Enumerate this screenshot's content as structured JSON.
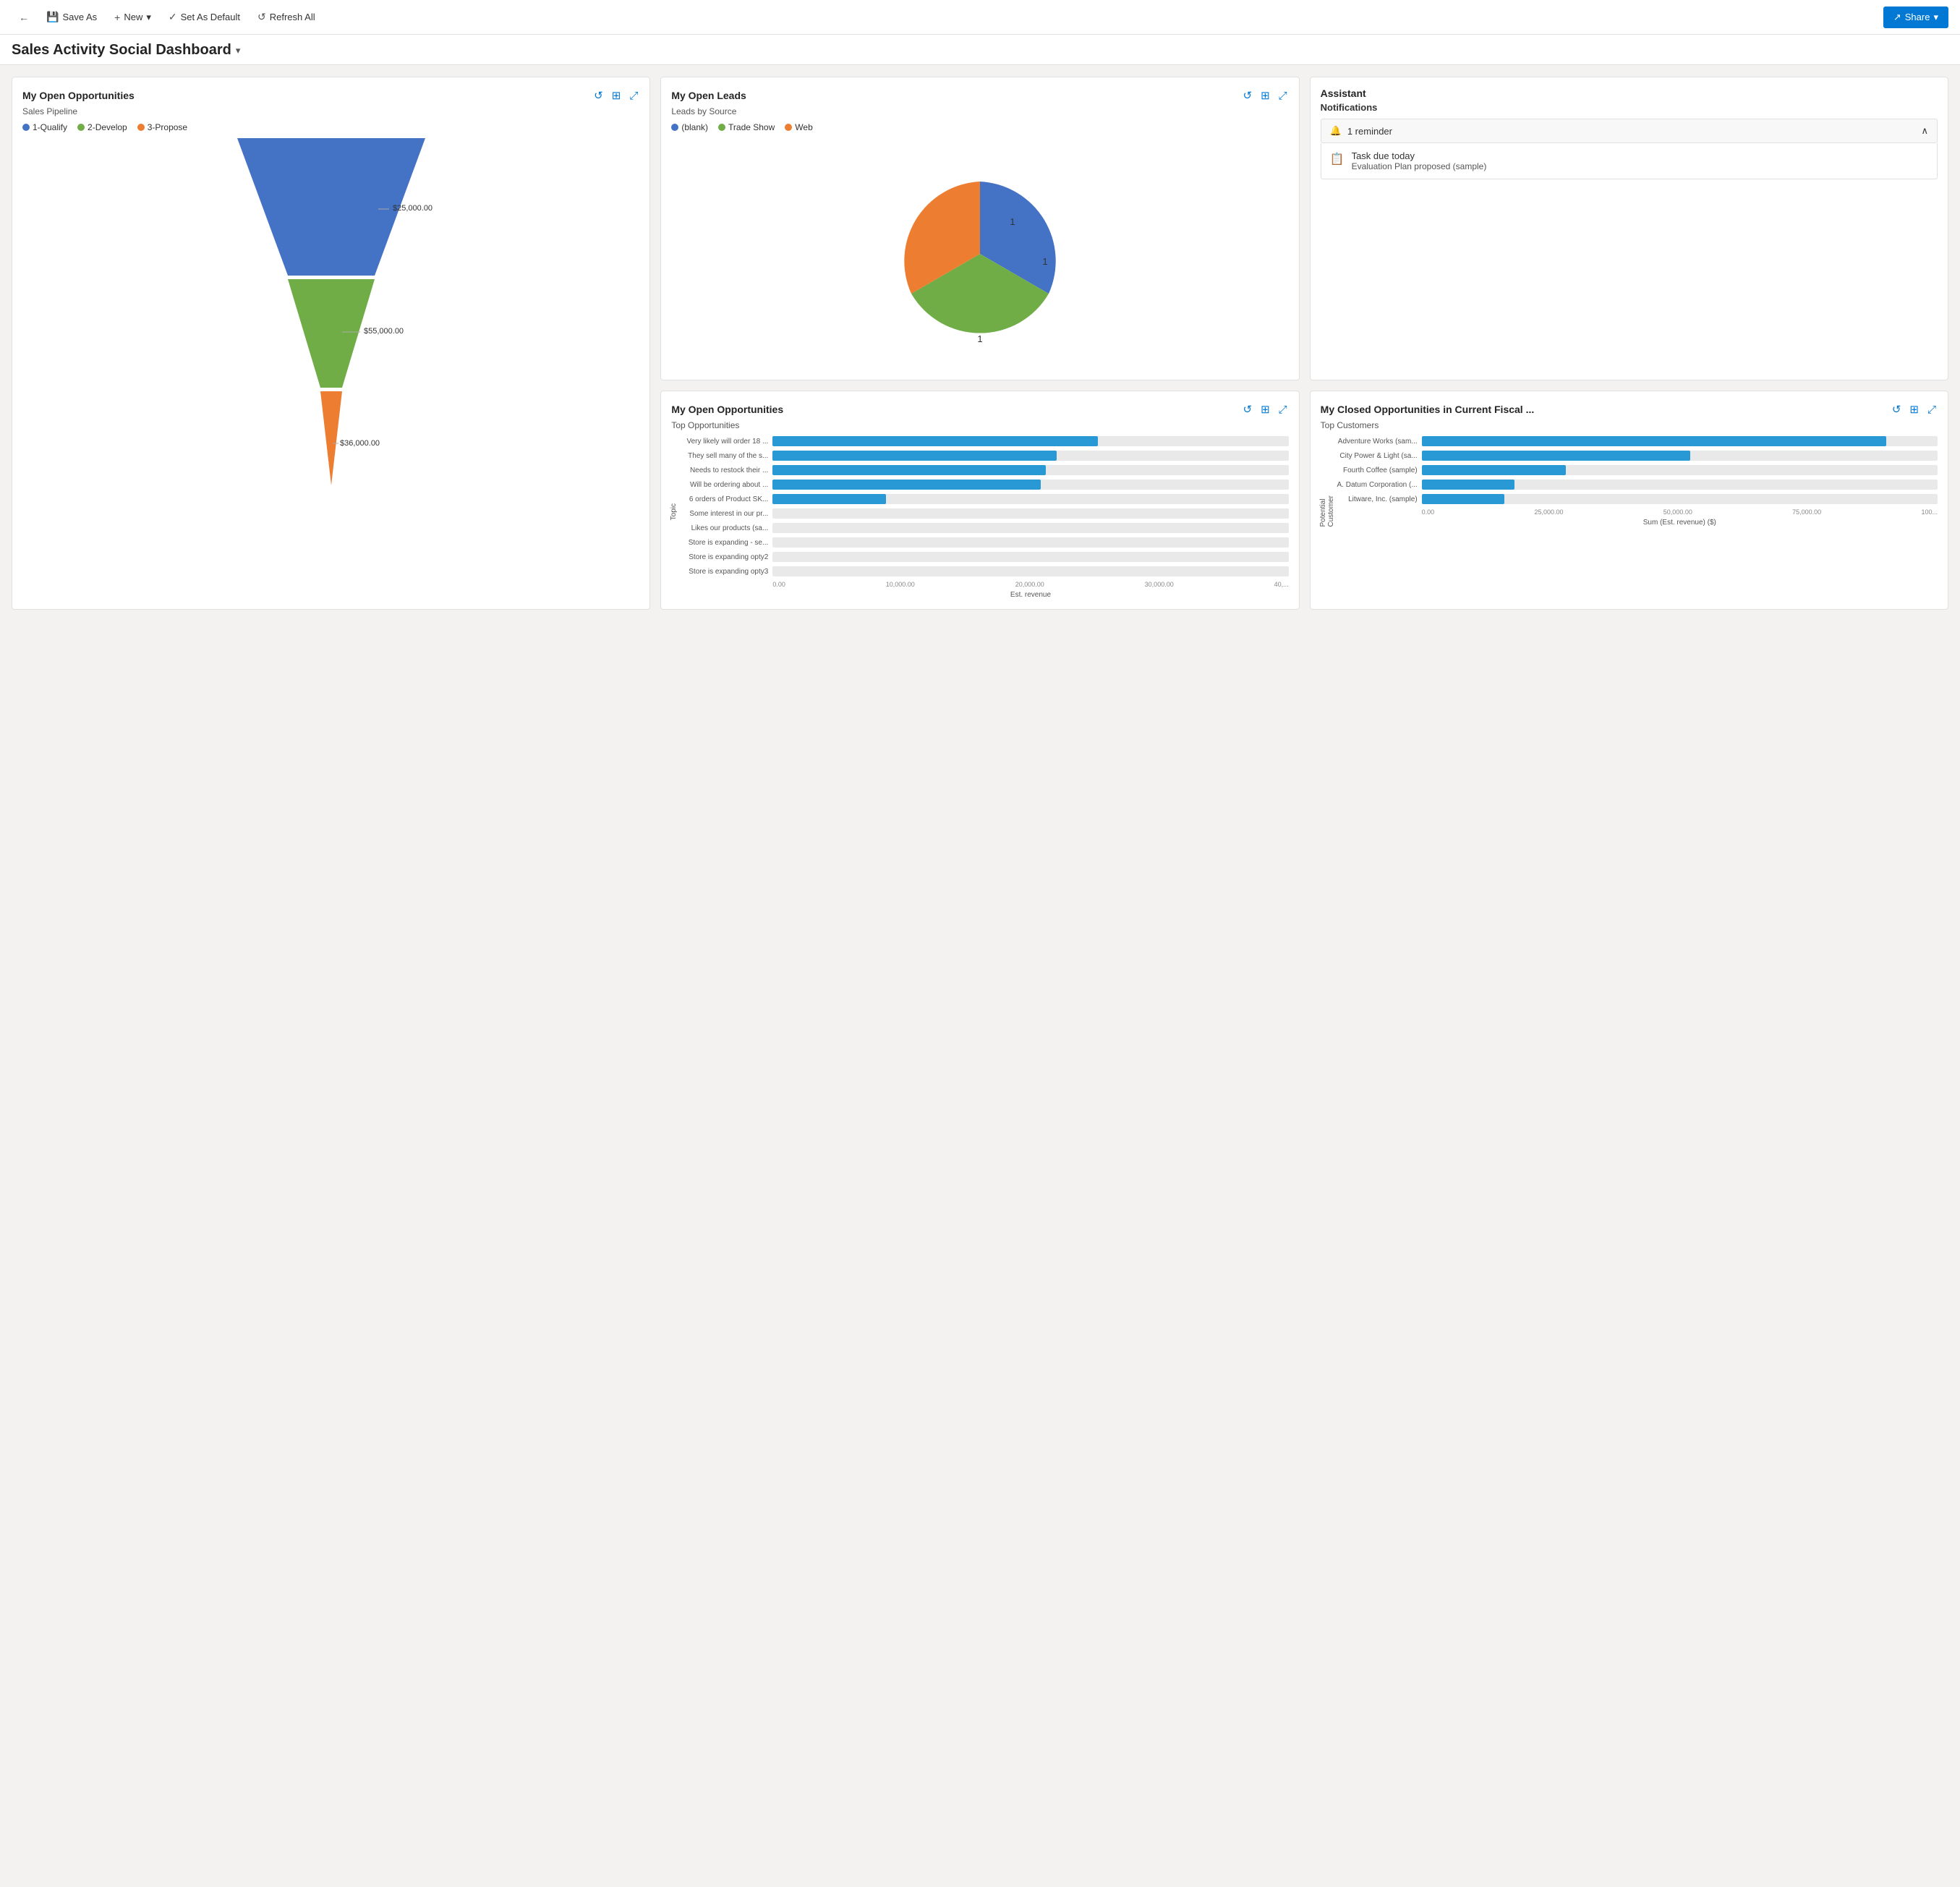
{
  "toolbar": {
    "back_icon": "←",
    "save_as_icon": "💾",
    "save_as_label": "Save As",
    "new_icon": "+",
    "new_label": "New",
    "new_dropdown_icon": "▾",
    "set_default_icon": "✓",
    "set_default_label": "Set As Default",
    "refresh_icon": "↺",
    "refresh_label": "Refresh All",
    "share_icon": "↗",
    "share_label": "Share",
    "share_dropdown_icon": "▾"
  },
  "page_title": "Sales Activity Social Dashboard",
  "cards": {
    "opportunities": {
      "title": "My Open Opportunities",
      "subtitle": "Sales Pipeline",
      "legend": [
        {
          "label": "1-Qualify",
          "color": "#4472c4"
        },
        {
          "label": "2-Develop",
          "color": "#70ad47"
        },
        {
          "label": "3-Propose",
          "color": "#ed7d31"
        }
      ],
      "funnel": [
        {
          "label": "$25,000.00",
          "color": "#4472c4",
          "widthPct": 100,
          "heightPct": 38
        },
        {
          "label": "$55,000.00",
          "color": "#70ad47",
          "widthPct": 65,
          "heightPct": 38
        },
        {
          "label": "$36,000.00",
          "color": "#ed7d31",
          "widthPct": 25,
          "heightPct": 24
        }
      ],
      "refresh_title": "Refresh",
      "download_title": "Download",
      "expand_title": "Expand"
    },
    "leads": {
      "title": "My Open Leads",
      "subtitle": "Leads by Source",
      "legend": [
        {
          "label": "(blank)",
          "color": "#4472c4"
        },
        {
          "label": "Trade Show",
          "color": "#70ad47"
        },
        {
          "label": "Web",
          "color": "#ed7d31"
        }
      ],
      "pie": [
        {
          "label": "(blank)",
          "value": 1,
          "color": "#4472c4",
          "startAngle": 0,
          "endAngle": 120
        },
        {
          "label": "Trade Show",
          "value": 1,
          "color": "#70ad47",
          "startAngle": 120,
          "endAngle": 240
        },
        {
          "label": "Web",
          "value": 1,
          "color": "#ed7d31",
          "startAngle": 240,
          "endAngle": 360
        }
      ],
      "refresh_title": "Refresh",
      "download_title": "Download",
      "expand_title": "Expand"
    },
    "assistant": {
      "title": "Assistant",
      "notifications_label": "Notifications",
      "reminder_count": "1 reminder",
      "task_label": "Task due today",
      "task_detail": "Evaluation Plan proposed (sample)",
      "bell_icon": "🔔",
      "task_icon": "📋",
      "chevron_up": "∧"
    },
    "top_opportunities": {
      "title": "My Open Opportunities",
      "subtitle": "Top Opportunities",
      "y_axis_label": "Topic",
      "x_axis_label": "Est. revenue",
      "bars": [
        {
          "label": "Very likely will order 18 ...",
          "value": 63,
          "display": ""
        },
        {
          "label": "They sell many of the s...",
          "value": 55,
          "display": ""
        },
        {
          "label": "Needs to restock their ...",
          "value": 53,
          "display": ""
        },
        {
          "label": "Will be ordering about ...",
          "value": 52,
          "display": ""
        },
        {
          "label": "6 orders of Product SK...",
          "value": 22,
          "display": ""
        },
        {
          "label": "Some interest in our pr...",
          "value": 0,
          "display": ""
        },
        {
          "label": "Likes our products (sa...",
          "value": 0,
          "display": ""
        },
        {
          "label": "Store is expanding - se...",
          "value": 0,
          "display": ""
        },
        {
          "label": "Store is expanding opty2",
          "value": 0,
          "display": ""
        },
        {
          "label": "Store is expanding opty3",
          "value": 0,
          "display": ""
        }
      ],
      "x_axis_ticks": [
        "0.00",
        "10,000.00",
        "20,000.00",
        "30,000.00",
        "40,..."
      ],
      "refresh_title": "Refresh",
      "download_title": "Download",
      "expand_title": "Expand"
    },
    "closed_opportunities": {
      "title": "My Closed Opportunities in Current Fiscal ...",
      "subtitle": "Top Customers",
      "y_axis_label": "Potential Customer",
      "x_axis_label": "Sum (Est. revenue) ($)",
      "bars": [
        {
          "label": "Adventure Works (sam...",
          "value": 90,
          "display": ""
        },
        {
          "label": "City Power & Light (sa...",
          "value": 52,
          "display": ""
        },
        {
          "label": "Fourth Coffee (sample)",
          "value": 28,
          "display": ""
        },
        {
          "label": "A. Datum Corporation (...",
          "value": 18,
          "display": ""
        },
        {
          "label": "Litware, Inc. (sample)",
          "value": 16,
          "display": ""
        }
      ],
      "x_axis_ticks": [
        "0.00",
        "25,000.00",
        "50,000.00",
        "75,000.00",
        "100..."
      ],
      "refresh_title": "Refresh",
      "download_title": "Download",
      "expand_title": "Expand"
    }
  },
  "colors": {
    "qualify": "#4472c4",
    "develop": "#70ad47",
    "propose": "#ed7d31",
    "bar_blue": "#2899d4",
    "accent": "#0078d4"
  }
}
